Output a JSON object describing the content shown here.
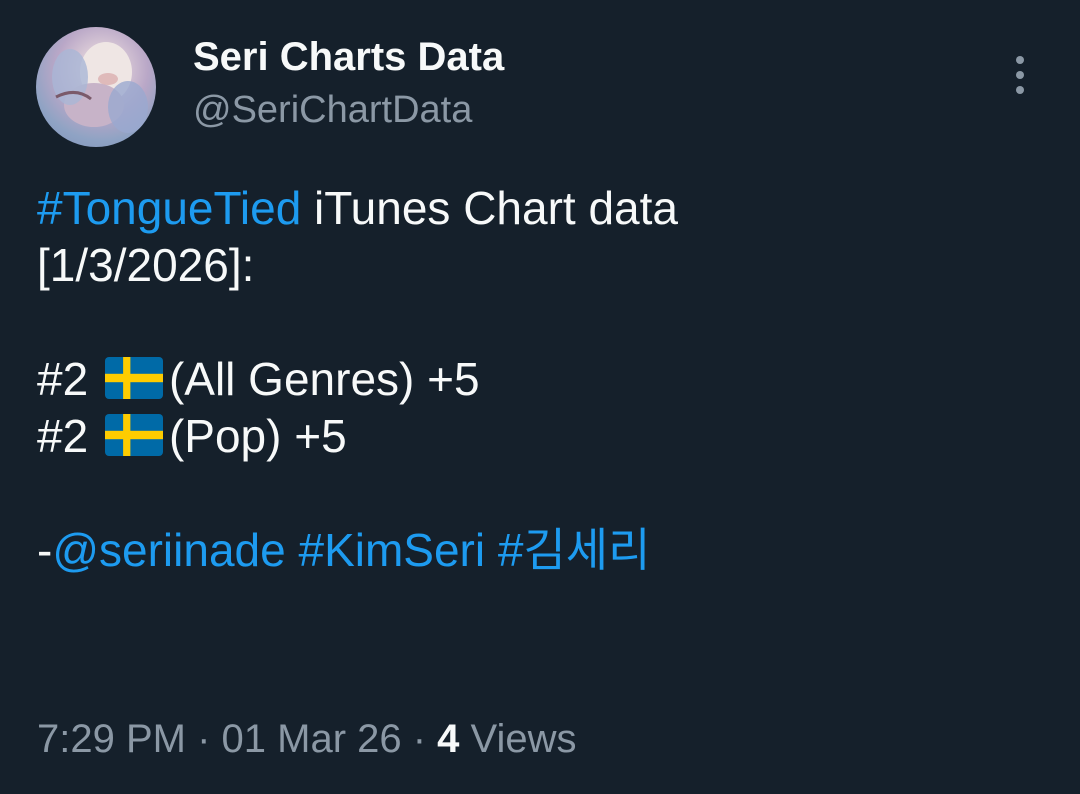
{
  "author": {
    "display_name": "Seri Charts Data",
    "handle": "@SeriChartData"
  },
  "tweet": {
    "hashtag_song": "#TongueTied",
    "title_rest": " iTunes Chart data",
    "date_line": "[1/3/2026]:",
    "chart_lines": [
      {
        "rank": "#2",
        "flag": "sweden-flag-icon",
        "label": "(All Genres) +5"
      },
      {
        "rank": "#2",
        "flag": "sweden-flag-icon",
        "label": "(Pop) +5"
      }
    ],
    "credit_dash": "-",
    "credit_mention": "@seriinade",
    "hashtag_artist": "#KimSeri",
    "hashtag_artist_kr": "#김세리"
  },
  "meta": {
    "time": "7:29 PM",
    "sep1": " · ",
    "date": "01 Mar 26",
    "sep2": " · ",
    "views_count": "4",
    "views_label": " Views"
  },
  "colors": {
    "background": "#15202b",
    "text": "#f7f9f9",
    "secondary": "#8b98a5",
    "link": "#1d9bf0",
    "flag_blue": "#006aa7",
    "flag_yellow": "#fecc00"
  }
}
